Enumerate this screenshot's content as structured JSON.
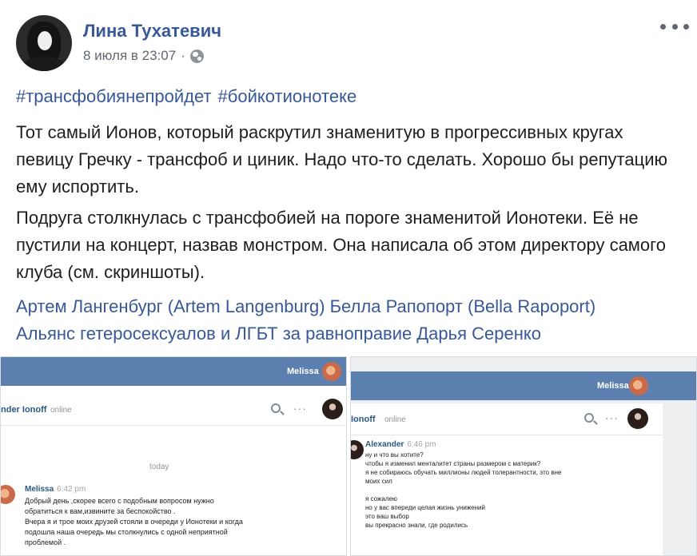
{
  "post": {
    "author": "Лина Тухатевич",
    "date": "8 июля в 23:07",
    "separator": "·",
    "hashtags": [
      "#трансфобиянепройдет",
      "#бойкотионотеке"
    ],
    "paragraph1": "Тот самый Ионов, который раскрутил знаменитую в прогрессивных кругах певицу Гречку - трансфоб и циник. Надо что-то сделать. Хорошо бы репутацию ему испортить.",
    "paragraph2": "Подруга столкнулась с трансфобией на пороге знаменитой Ионотеки. Её не пустили на концерт, назвав монстром. Она написала об этом директору самого клуба (см. скриншоты).",
    "tags": [
      "Артем Лангенбург (Artem Langenburg)",
      "Белла Рапопорт (Bella Rapoport)",
      "Альянс гетеросексуалов и ЛГБТ за равноправие",
      "Дарья Серенко"
    ]
  },
  "screenshot_left": {
    "topbar_user": "Melissa",
    "chat_title": "nder Ionoff",
    "chat_status": "online",
    "more_dots": "···",
    "day_separator": "today",
    "message_author": "Melissa",
    "message_time": "6:42 pm",
    "message_lines": [
      "Добрый день ,скорее всего с подобным вопросом нужно",
      "обратиться к вам,извините за беспокойство .",
      "Вчера я и трое моих друзей стояли в очереди у Ионотеки и когда",
      "подошла наша очередь мы столкнулись с одной неприятной",
      "проблемой ."
    ]
  },
  "screenshot_right": {
    "topbar_user": "Melissa",
    "chat_title": "Ionoff",
    "chat_status": "online",
    "more_dots": "···",
    "message_author": "Alexander",
    "message_time": "6:46 pm",
    "message_lines": [
      "ну и что вы хотите?",
      "чтобы я изменил менталитет страны размером с материк?",
      "я не собираюсь обучать миллионы людей толерантности, это вне",
      "моих сил",
      "",
      "я сожалею",
      "но у вас впереди целая жизнь унижений",
      "это ваш выбор",
      "вы прекрасно знали, где родились"
    ]
  },
  "colors": {
    "link": "#385898",
    "text": "#1c1e21",
    "meta": "#606770",
    "vk_header": "#5b7fae"
  }
}
